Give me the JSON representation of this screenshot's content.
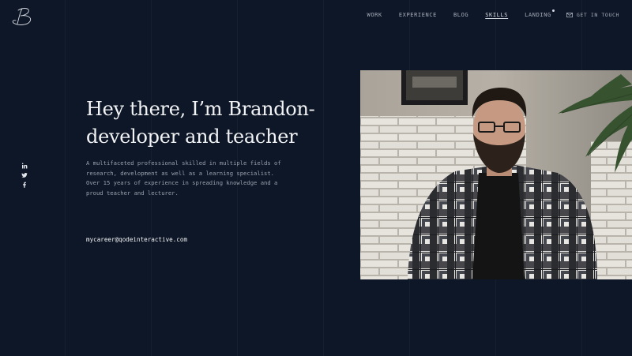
{
  "brand": {
    "logo_icon": "script-b-monogram-icon"
  },
  "nav": {
    "items": [
      {
        "label": "WORK",
        "active": false
      },
      {
        "label": "EXPERIENCE",
        "active": false
      },
      {
        "label": "BLOG",
        "active": false
      },
      {
        "label": "SKILLS",
        "active": true
      },
      {
        "label": "LANDING",
        "active": false,
        "badge": "dot"
      }
    ],
    "contact": {
      "label": "GET IN TOUCH",
      "icon": "envelope-icon"
    }
  },
  "social": {
    "icons": [
      "facebook-icon",
      "twitter-icon",
      "linkedin-icon"
    ]
  },
  "hero": {
    "headline_line1": "Hey there, I’m Brandon-",
    "headline_line2": "developer and teacher",
    "bio_lines": [
      "A multifaceted professional skilled in multiple fields of",
      "research, development as well as a learning specialist.",
      "Over 15 years of experience in spreading knowledge and a",
      "proud teacher and lecturer."
    ],
    "email": "mycareer@qodeinteractive.com"
  },
  "photo": {
    "alt": "portrait-photo"
  },
  "colors": {
    "background": "#0e1727",
    "text_primary": "#f2f3f5",
    "text_muted": "#98a0ae"
  }
}
